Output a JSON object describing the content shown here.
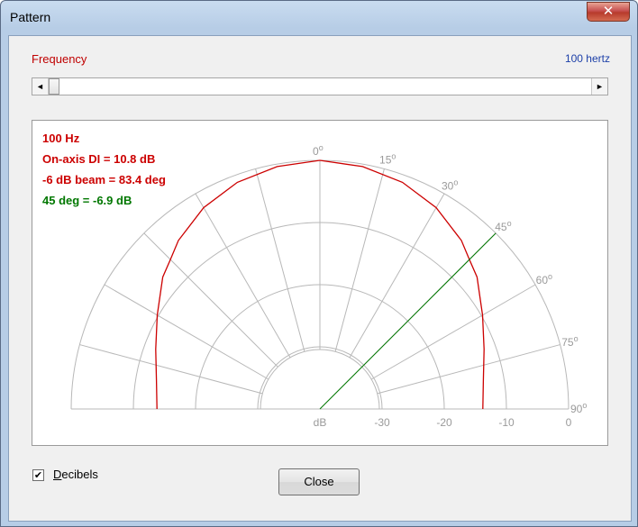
{
  "window": {
    "title": "Pattern",
    "close_glyph": "✕"
  },
  "frequency": {
    "label": "Frequency",
    "value_text": "100 hertz"
  },
  "scrollbar": {
    "left_arrow": "◄",
    "right_arrow": "►",
    "position_fraction": 0.0
  },
  "info": {
    "freq": "100 Hz",
    "di": "On-axis DI = 10.8 dB",
    "beam": "-6 dB beam = 83.4 deg",
    "deg45": "45 deg = -6.9 dB",
    "colors": {
      "primary": "#cc0000",
      "secondary": "#007700"
    }
  },
  "chart_data": {
    "type": "polar",
    "angle_labels": [
      "0°",
      "15°",
      "30°",
      "45°",
      "60°",
      "75°",
      "90°"
    ],
    "angle_suffix": "o",
    "angle_values": [
      0,
      15,
      30,
      45,
      60,
      75,
      90
    ],
    "radial_tick_labels": [
      "dB",
      "-30",
      "-20",
      "-10",
      "0"
    ],
    "radial_tick_values": [
      -40,
      -30,
      -20,
      -10,
      0
    ],
    "rlim": [
      -40,
      0
    ],
    "grid": true,
    "series": [
      {
        "color": "#cc0000",
        "angles_deg": [
          0,
          10,
          20,
          30,
          40,
          45,
          50,
          60,
          70,
          80,
          90
        ],
        "values_db": [
          0,
          -0.4,
          -1.2,
          -2.6,
          -4.6,
          -6.0,
          -7.0,
          -9.8,
          -11.9,
          -13.3,
          -13.8
        ]
      }
    ],
    "reference_line": {
      "angle_deg": 45,
      "value_db": 0,
      "color": "#007700"
    }
  },
  "checkbox": {
    "label": "Decibels",
    "checked": true,
    "mark": "✔"
  },
  "close_button": {
    "label": "Close"
  }
}
